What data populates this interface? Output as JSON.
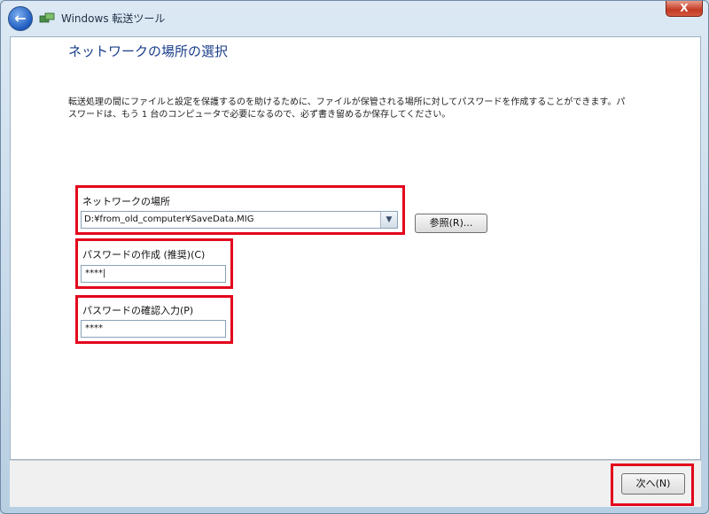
{
  "window": {
    "title": "Windows 転送ツール",
    "close_label": "X"
  },
  "page": {
    "title": "ネットワークの場所の選択",
    "description": "転送処理の間にファイルと設定を保護するのを助けるために、ファイルが保管される場所に対してパスワードを作成することができます。パスワードは、もう 1 台のコンピュータで必要になるので、必ず書き留めるか保存してください。"
  },
  "network_location": {
    "label": "ネットワークの場所",
    "value": "D:¥from_old_computer¥SaveData.MIG",
    "browse_label": "参照(R)..."
  },
  "password": {
    "label": "パスワードの作成 (推奨)(C)",
    "value": "****|"
  },
  "confirm_password": {
    "label": "パスワードの確認入力(P)",
    "value": "****"
  },
  "footer": {
    "next_label": "次へ(N)"
  },
  "icons": {
    "back": "back-arrow-icon",
    "app": "transfer-tool-icon",
    "dropdown": "chevron-down-icon"
  },
  "colors": {
    "highlight": "#e3061c",
    "title": "#1a3e8c"
  }
}
